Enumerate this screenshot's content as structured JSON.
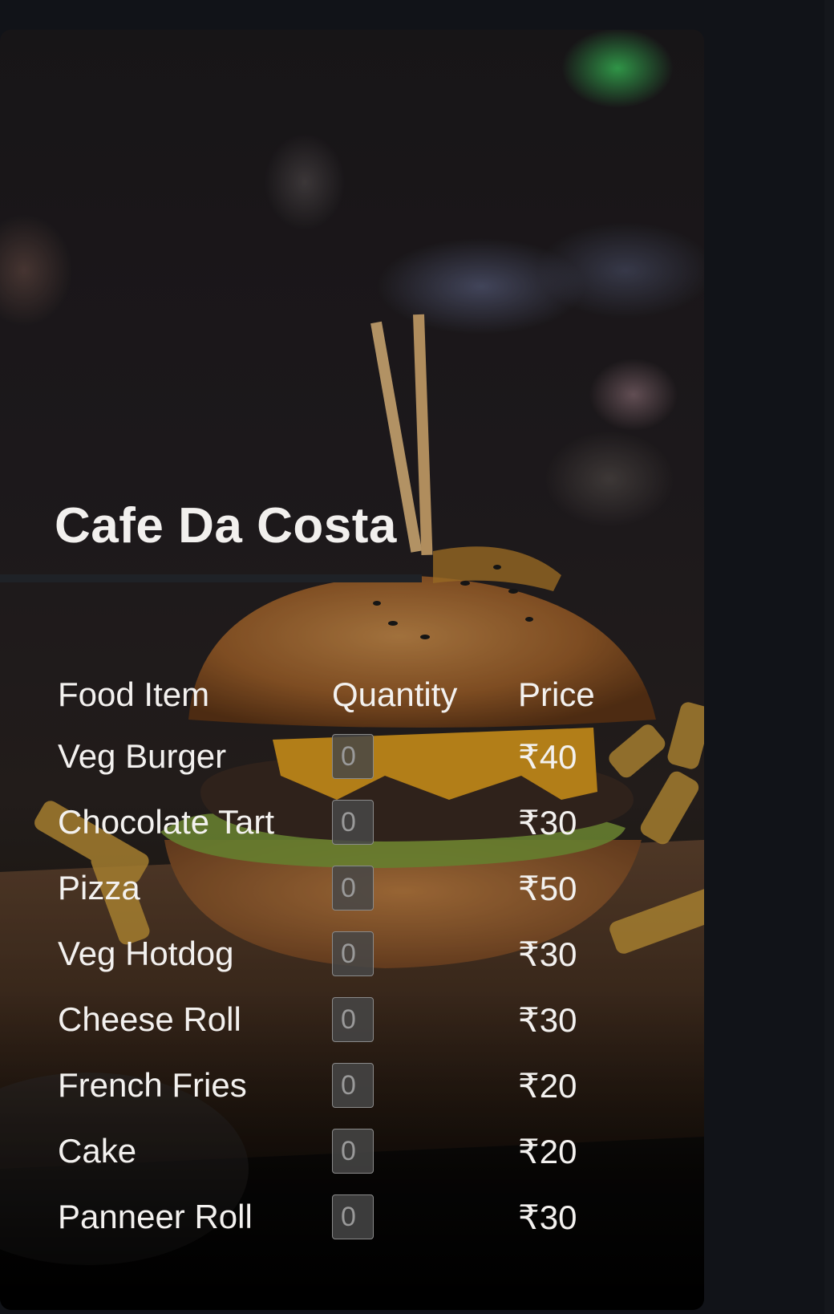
{
  "cafe": {
    "title": "Cafe Da Costa"
  },
  "menu": {
    "headers": {
      "item": "Food Item",
      "quantity": "Quantity",
      "price": "Price"
    },
    "items": [
      {
        "name": "Veg Burger",
        "quantity_placeholder": "0",
        "price": "₹40"
      },
      {
        "name": "Chocolate Tart",
        "quantity_placeholder": "0",
        "price": "₹30"
      },
      {
        "name": "Pizza",
        "quantity_placeholder": "0",
        "price": "₹50"
      },
      {
        "name": "Veg Hotdog",
        "quantity_placeholder": "0",
        "price": "₹30"
      },
      {
        "name": "Cheese Roll",
        "quantity_placeholder": "0",
        "price": "₹30"
      },
      {
        "name": "French Fries",
        "quantity_placeholder": "0",
        "price": "₹20"
      },
      {
        "name": "Cake",
        "quantity_placeholder": "0",
        "price": "₹20"
      },
      {
        "name": "Panneer Roll",
        "quantity_placeholder": "0",
        "price": "₹30"
      }
    ]
  },
  "colors": {
    "page_background": "#111318",
    "text": "#f3f1ef",
    "input_background": "#464646"
  }
}
